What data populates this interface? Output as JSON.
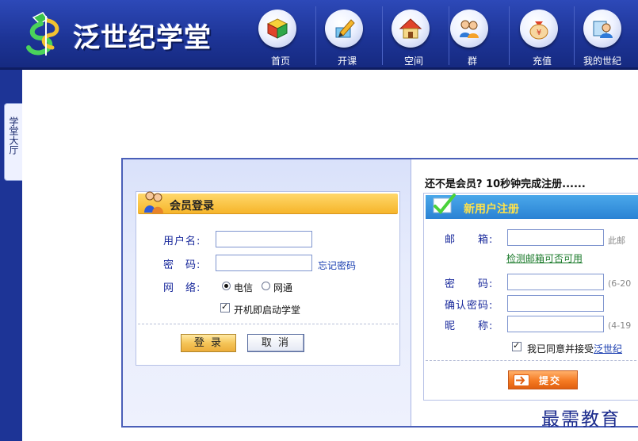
{
  "app": {
    "title": "泛世纪学堂"
  },
  "nav": {
    "items": [
      {
        "label": "首页",
        "icon": "cube-icon"
      },
      {
        "label": "开课",
        "icon": "pencil-icon"
      },
      {
        "label": "空间",
        "icon": "house-icon"
      },
      {
        "label": "群",
        "icon": "group-icon"
      },
      {
        "label": "充值",
        "icon": "money-bag-icon"
      },
      {
        "label": "我的世纪",
        "icon": "user-icon"
      }
    ]
  },
  "sidebar": {
    "tab_label": "学堂大厅"
  },
  "login": {
    "title": "会员登录",
    "username_label": "用户名:",
    "username_value": "",
    "password_label": "密　码:",
    "password_value": "",
    "forgot_password": "忘记密码",
    "network_label": "网　络:",
    "network_options": [
      "电信",
      "网通"
    ],
    "network_selected": "电信",
    "autostart_label": "开机即启动学堂",
    "autostart_checked": true,
    "login_button": "登 录",
    "cancel_button": "取 消"
  },
  "register": {
    "prompt": "还不是会员? 10秒钟完成注册......",
    "title": "新用户注册",
    "email_label": "邮　　箱:",
    "email_value": "",
    "email_hint": "此邮",
    "check_email_link": "检测邮箱可否可用",
    "password_label": "密　　码:",
    "password_hint": "(6-20",
    "confirm_password_label": "确认密码:",
    "nickname_label": "昵　　称:",
    "nickname_hint": "(4-19",
    "agree_text": "我已同意并接受",
    "agree_link": "泛世纪",
    "agree_checked": true,
    "submit_button": "提交"
  },
  "watermark": "最需教育",
  "colors": {
    "header_blue": "#1d3496",
    "login_header": "#f6b52a",
    "register_header": "#2a82d4",
    "submit_orange": "#f57a22",
    "link_blue": "#1a3eb0"
  }
}
